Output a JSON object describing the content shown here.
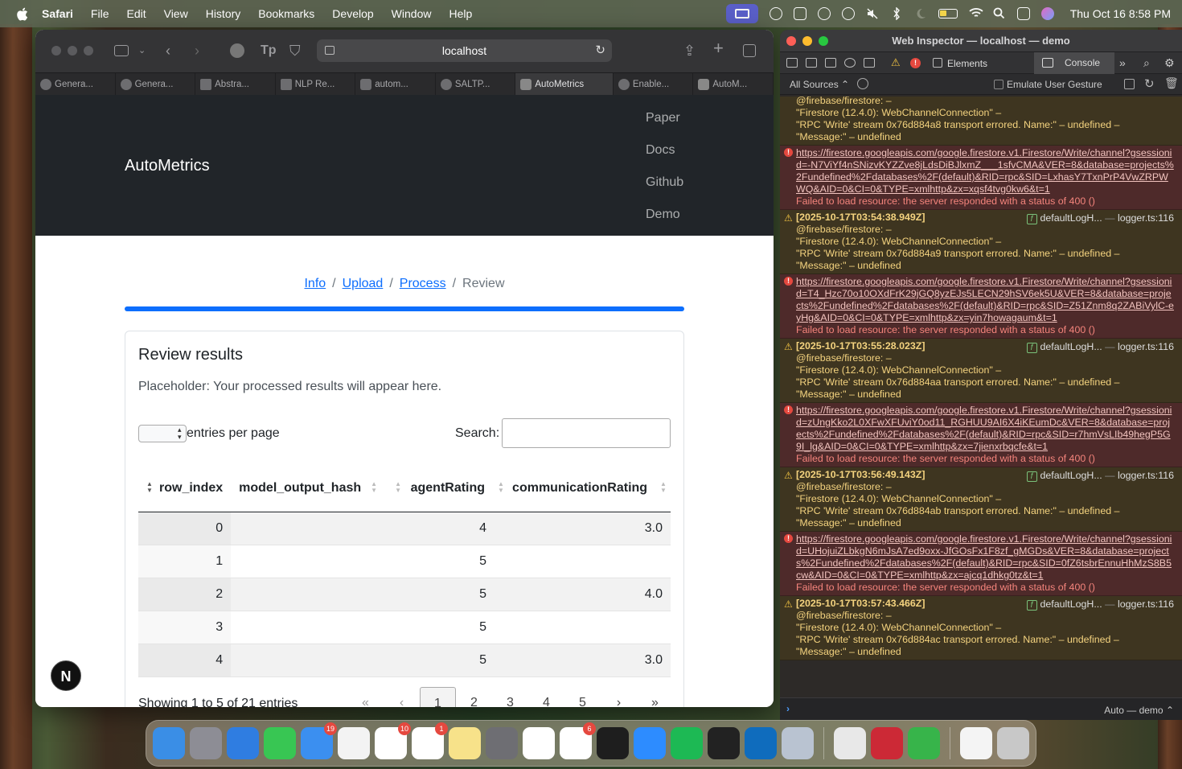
{
  "menubar": {
    "app": "Safari",
    "items": [
      "File",
      "Edit",
      "View",
      "History",
      "Bookmarks",
      "Develop",
      "Window",
      "Help"
    ],
    "clock": "Thu Oct 16  8:58 PM"
  },
  "safari": {
    "url": "localhost",
    "tabs": [
      "Genera...",
      "Genera...",
      "Abstra...",
      "NLP Re...",
      "autom...",
      "SALTP...",
      "AutoMetrics",
      "Enable...",
      "AutoM..."
    ],
    "active_tab": 6
  },
  "site": {
    "brand": "AutoMetrics",
    "nav": [
      "Paper",
      "Docs",
      "Github",
      "Demo"
    ]
  },
  "breadcrumb": {
    "info": "Info",
    "upload": "Upload",
    "process": "Process",
    "current": "Review",
    "sep": "/"
  },
  "review": {
    "title": "Review results",
    "placeholder": "Placeholder: Your processed results will appear here.",
    "epp_label": "entries per page",
    "search_label": "Search:",
    "columns": [
      "row_index",
      "model_output_hash",
      "agentRating",
      "communicationRating"
    ],
    "rows": [
      {
        "row_index": "0",
        "model_output_hash": "",
        "agentRating": "4",
        "communicationRating": "3.0"
      },
      {
        "row_index": "1",
        "model_output_hash": "",
        "agentRating": "5",
        "communicationRating": ""
      },
      {
        "row_index": "2",
        "model_output_hash": "",
        "agentRating": "5",
        "communicationRating": "4.0"
      },
      {
        "row_index": "3",
        "model_output_hash": "",
        "agentRating": "5",
        "communicationRating": ""
      },
      {
        "row_index": "4",
        "model_output_hash": "",
        "agentRating": "5",
        "communicationRating": "3.0"
      }
    ],
    "showing": "Showing 1 to 5 of 21 entries",
    "pager": [
      "«",
      "‹",
      "1",
      "2",
      "3",
      "4",
      "5",
      "›",
      "»"
    ]
  },
  "badge": "N",
  "inspector": {
    "title": "Web Inspector — localhost — demo",
    "tab_elements": "Elements",
    "tab_console": "Console",
    "sources": "All Sources",
    "emulate": "Emulate User Gesture",
    "context": "Auto — demo",
    "entries": [
      {
        "type": "warn-tail",
        "lines": [
          "@firebase/firestore: –",
          "\"Firestore (12.4.0): WebChannelConnection\" –",
          "\"RPC 'Write' stream 0x76d884a8 transport errored. Name:\" – undefined –",
          "\"Message:\" – undefined"
        ]
      },
      {
        "type": "err",
        "url": "https://firestore.googleapis.com/google.firestore.v1.Firestore/Write/channel?gsessionid=-N7ViYf4nSNizvKYZZve8jLdsDiBJlxmZ___1sfvCMA&VER=8&database=projects%2Fundefined%2Fdatabases%2F(default)&RID=rpc&SID=LxhasY7TxnPrP4VwZRPWWQ&AID=0&CI=0&TYPE=xmlhttp&zx=xqsf4tvg0kw6&t=1",
        "msg": "Failed to load resource: the server responded with a status of 400 ()"
      },
      {
        "type": "warn",
        "ts": "[2025-10-17T03:54:38.949Z]",
        "fn": "defaultLogH...",
        "src": "logger.ts:116",
        "lines": [
          "@firebase/firestore: –",
          "\"Firestore (12.4.0): WebChannelConnection\" –",
          "\"RPC 'Write' stream 0x76d884a9 transport errored. Name:\" – undefined –",
          "\"Message:\" – undefined"
        ]
      },
      {
        "type": "err",
        "url": "https://firestore.googleapis.com/google.firestore.v1.Firestore/Write/channel?gsessionid=T4_Hzc70o10OXdFrK29jGQ8yzEJs5LECN29hSV6ek5U&VER=8&database=projects%2Fundefined%2Fdatabases%2F(default)&RID=rpc&SID=Z51Znm8q2ZABiVylC-eyHg&AID=0&CI=0&TYPE=xmlhttp&zx=yin7howagaum&t=1",
        "msg": "Failed to load resource: the server responded with a status of 400 ()"
      },
      {
        "type": "warn",
        "ts": "[2025-10-17T03:55:28.023Z]",
        "fn": "defaultLogH...",
        "src": "logger.ts:116",
        "lines": [
          "@firebase/firestore: –",
          "\"Firestore (12.4.0): WebChannelConnection\" –",
          "\"RPC 'Write' stream 0x76d884aa transport errored. Name:\" – undefined –",
          "\"Message:\" – undefined"
        ]
      },
      {
        "type": "err",
        "url": "https://firestore.googleapis.com/google.firestore.v1.Firestore/Write/channel?gsessionid=zUngKko2L0XFwXFUviY0od11_RGHUU9AI6X4iKEumDc&VER=8&database=projects%2Fundefined%2Fdatabases%2F(default)&RID=rpc&SID=r7hmVsLIb49hegP5G9I_lg&AID=0&CI=0&TYPE=xmlhttp&zx=7jienxrbqcfe&t=1",
        "msg": "Failed to load resource: the server responded with a status of 400 ()"
      },
      {
        "type": "warn",
        "ts": "[2025-10-17T03:56:49.143Z]",
        "fn": "defaultLogH...",
        "src": "logger.ts:116",
        "lines": [
          "@firebase/firestore: –",
          "\"Firestore (12.4.0): WebChannelConnection\" –",
          "\"RPC 'Write' stream 0x76d884ab transport errored. Name:\" – undefined –",
          "\"Message:\" – undefined"
        ]
      },
      {
        "type": "err",
        "url": "https://firestore.googleapis.com/google.firestore.v1.Firestore/Write/channel?gsessionid=UHojuiZLbkgN6mJsA7ed9oxx-JfGOsFx1F8zf_gMGDs&VER=8&database=projects%2Fundefined%2Fdatabases%2F(default)&RID=rpc&SID=0fZ6tsbrEnnuHhMzS8B5cw&AID=0&CI=0&TYPE=xmlhttp&zx=ajcq1dhkg0tz&t=1",
        "msg": "Failed to load resource: the server responded with a status of 400 ()"
      },
      {
        "type": "warn",
        "ts": "[2025-10-17T03:57:43.466Z]",
        "fn": "defaultLogH...",
        "src": "logger.ts:116",
        "lines": [
          "@firebase/firestore: –",
          "\"Firestore (12.4.0): WebChannelConnection\" –",
          "\"RPC 'Write' stream 0x76d884ac transport errored. Name:\" – undefined –",
          "\"Message:\" – undefined"
        ]
      }
    ]
  },
  "dock": {
    "apps": [
      {
        "name": "finder-icon",
        "color": "#3a8ee6"
      },
      {
        "name": "launchpad-icon",
        "color": "#8d8d95"
      },
      {
        "name": "safari-icon",
        "color": "#2f7de1"
      },
      {
        "name": "messages-icon",
        "color": "#38c653"
      },
      {
        "name": "mail-icon",
        "color": "#3b8ff0",
        "badge": "19"
      },
      {
        "name": "photos-icon",
        "color": "#f3f3f3"
      },
      {
        "name": "calendar-icon",
        "color": "#ffffff",
        "badge": "10"
      },
      {
        "name": "reminders-icon",
        "color": "#ffffff",
        "badge": "1"
      },
      {
        "name": "notes-icon",
        "color": "#f7e28a"
      },
      {
        "name": "settings-icon",
        "color": "#6e6e73"
      },
      {
        "name": "chatgpt-icon",
        "color": "#ffffff"
      },
      {
        "name": "slack-icon",
        "color": "#ffffff",
        "badge": "6"
      },
      {
        "name": "terminal-icon",
        "color": "#1e1e1e"
      },
      {
        "name": "zoom-icon",
        "color": "#2d8cff"
      },
      {
        "name": "spotify-icon",
        "color": "#1db954"
      },
      {
        "name": "cursor-icon",
        "color": "#222222"
      },
      {
        "name": "outlook-icon",
        "color": "#0f6cbd"
      },
      {
        "name": "preview-icon",
        "color": "#b9c3d1"
      },
      {
        "name": "chrome-icon",
        "color": "#e8e8e8"
      },
      {
        "name": "zotero-icon",
        "color": "#cc2936"
      },
      {
        "name": "numbers-icon",
        "color": "#37b44a"
      },
      {
        "name": "document-icon",
        "color": "#f4f4f4"
      },
      {
        "name": "trash-icon",
        "color": "#c8c8c8"
      }
    ]
  }
}
